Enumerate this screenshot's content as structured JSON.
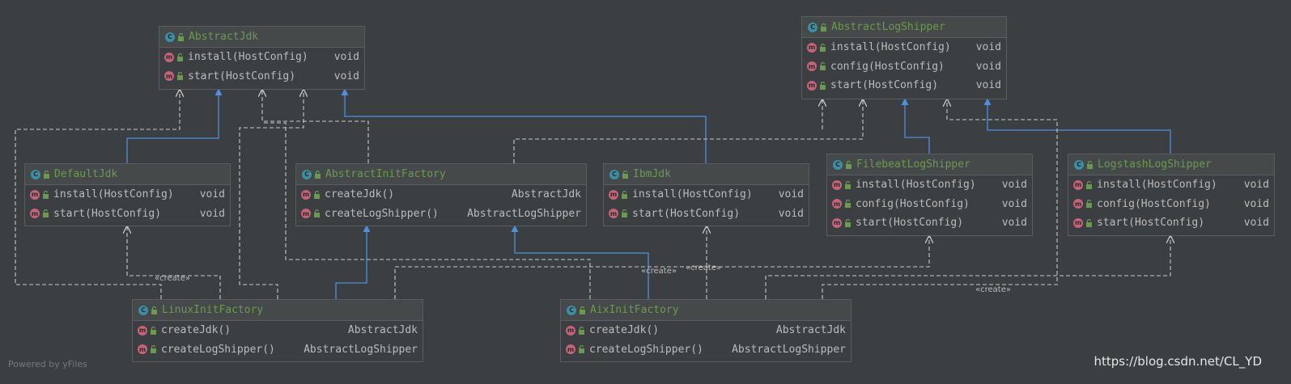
{
  "classes": [
    {
      "name": "AbstractJdk",
      "methods": [
        {
          "name": "install(HostConfig)",
          "ret": "void"
        },
        {
          "name": "start(HostConfig)",
          "ret": "void"
        }
      ]
    },
    {
      "name": "AbstractLogShipper",
      "methods": [
        {
          "name": "install(HostConfig)",
          "ret": "void"
        },
        {
          "name": "config(HostConfig)",
          "ret": "void"
        },
        {
          "name": "start(HostConfig)",
          "ret": "void"
        }
      ]
    },
    {
      "name": "DefaultJdk",
      "methods": [
        {
          "name": "install(HostConfig)",
          "ret": "void"
        },
        {
          "name": "start(HostConfig)",
          "ret": "void"
        }
      ]
    },
    {
      "name": "AbstractInitFactory",
      "methods": [
        {
          "name": "createJdk()",
          "ret": "AbstractJdk"
        },
        {
          "name": "createLogShipper()",
          "ret": "AbstractLogShipper"
        }
      ]
    },
    {
      "name": "IbmJdk",
      "methods": [
        {
          "name": "install(HostConfig)",
          "ret": "void"
        },
        {
          "name": "start(HostConfig)",
          "ret": "void"
        }
      ]
    },
    {
      "name": "FilebeatLogShipper",
      "methods": [
        {
          "name": "install(HostConfig)",
          "ret": "void"
        },
        {
          "name": "config(HostConfig)",
          "ret": "void"
        },
        {
          "name": "start(HostConfig)",
          "ret": "void"
        }
      ]
    },
    {
      "name": "LogstashLogShipper",
      "methods": [
        {
          "name": "install(HostConfig)",
          "ret": "void"
        },
        {
          "name": "config(HostConfig)",
          "ret": "void"
        },
        {
          "name": "start(HostConfig)",
          "ret": "void"
        }
      ]
    },
    {
      "name": "LinuxInitFactory",
      "methods": [
        {
          "name": "createJdk()",
          "ret": "AbstractJdk"
        },
        {
          "name": "createLogShipper()",
          "ret": "AbstractLogShipper"
        }
      ]
    },
    {
      "name": "AixInitFactory",
      "methods": [
        {
          "name": "createJdk()",
          "ret": "AbstractJdk"
        },
        {
          "name": "createLogShipper()",
          "ret": "AbstractLogShipper"
        }
      ]
    }
  ],
  "edge_labels": {
    "create": "«create»"
  },
  "watermarks": {
    "left": "Powered by yFiles",
    "right": "https://blog.csdn.net/CL_YD"
  },
  "colors": {
    "background": "#3c3f41",
    "inheritance": "#4d8fe0",
    "dependency": "#c8c8c8",
    "class_name": "#6a9a4e",
    "class_icon": "#3c8fa3",
    "method_icon": "#c5637a"
  },
  "icons": {
    "class": "class-icon",
    "method": "method-icon",
    "visibility": "public-lock-icon"
  },
  "icon_letters": {
    "class": "C",
    "method": "m"
  }
}
